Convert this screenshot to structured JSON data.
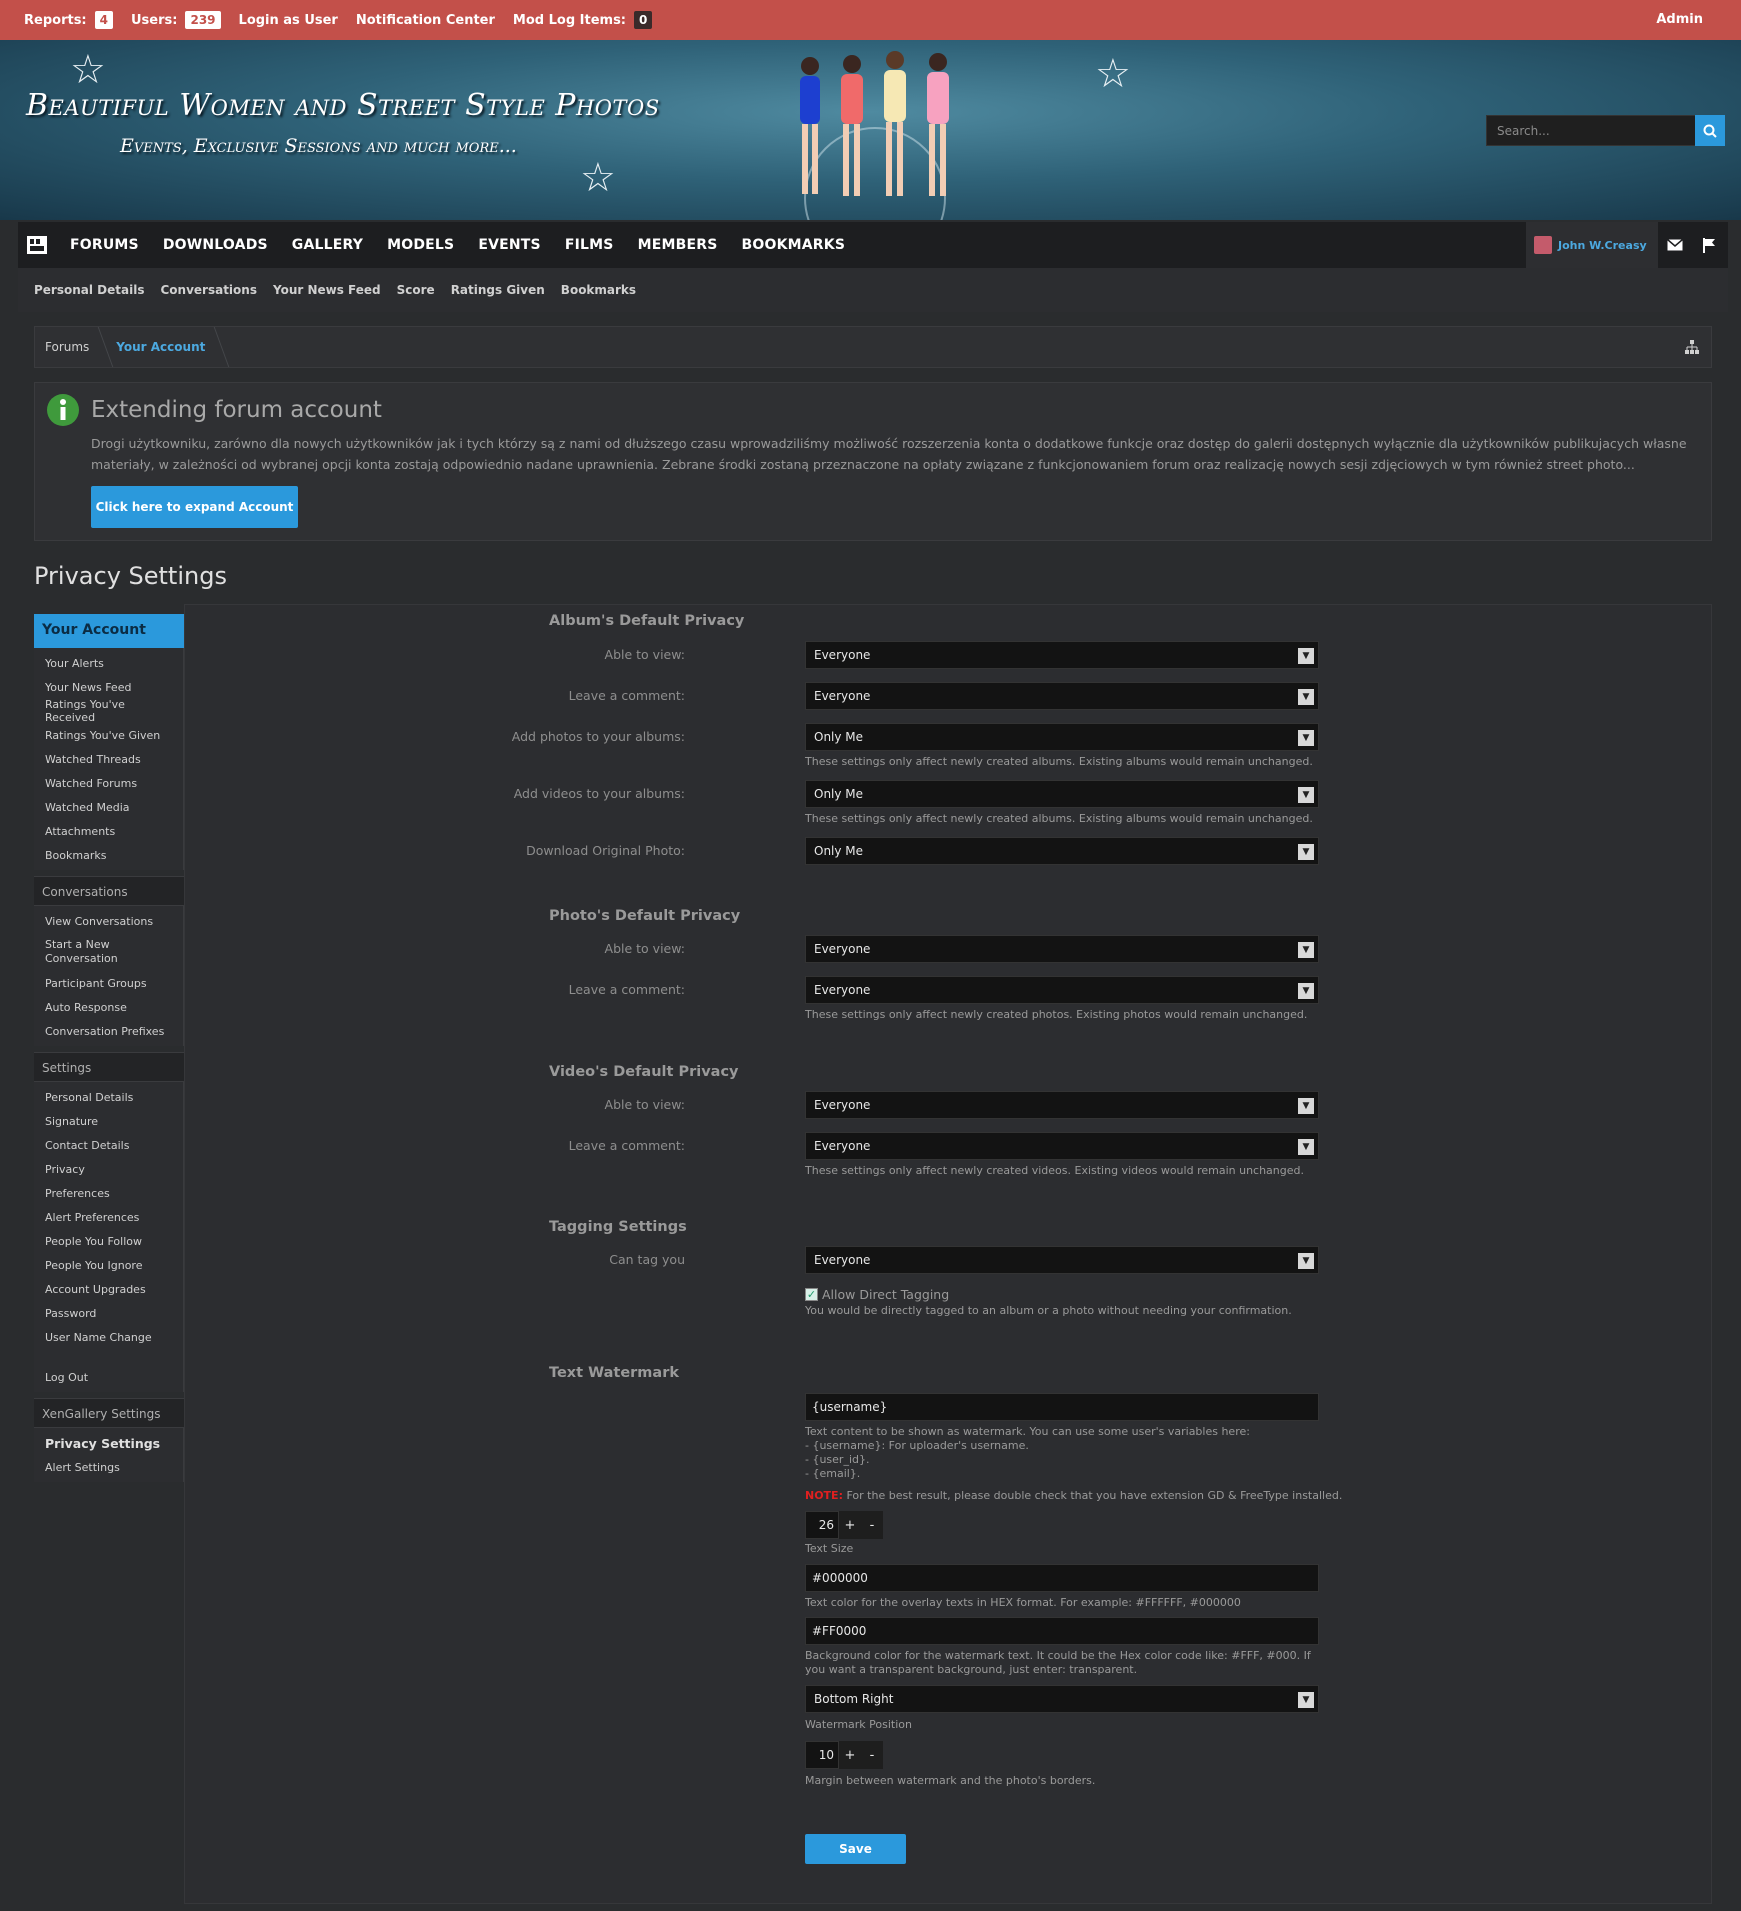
{
  "admin_bar": {
    "reports_label": "Reports:",
    "reports_count": "4",
    "users_label": "Users:",
    "users_count": "239",
    "login_as_user": "Login as User",
    "notification_center": "Notification Center",
    "mod_log_label": "Mod Log Items:",
    "mod_log_count": "0",
    "admin": "Admin"
  },
  "banner": {
    "title": "Beautiful Women and Street Style Photos",
    "subtitle": "Events, Exclusive Sessions and much more...",
    "search_placeholder": "Search..."
  },
  "nav": {
    "tabs": [
      "FORUMS",
      "DOWNLOADS",
      "GALLERY",
      "MODELS",
      "EVENTS",
      "FILMS",
      "MEMBERS",
      "BOOKMARKS"
    ],
    "username": "John W.Creasy"
  },
  "subnav": [
    "Personal Details",
    "Conversations",
    "Your News Feed",
    "Score",
    "Ratings Given",
    "Bookmarks"
  ],
  "breadcrumb": {
    "home": "Forums",
    "current": "Your Account"
  },
  "notice": {
    "title": "Extending forum account",
    "body": "Drogi użytkowniku, zarówno dla nowych użytkowników jak i tych którzy są z nami od dłuższego czasu wprowadziliśmy możliwość rozszerzenia konta o dodatkowe funkcje oraz dostęp do galerii dostępnych wyłącznie dla użytkowników publikujacych własne materiały, w zależności od wybranej opcji konta zostają odpowiednio nadane uprawnienia. Zebrane środki zostaną przeznaczone na opłaty związane z funkcjonowaniem forum oraz realizację nowych sesji zdjęciowych w tym również street photo...",
    "button": "Click here to expand Account"
  },
  "page_title": "Privacy Settings",
  "sidebar": {
    "head": "Your Account",
    "account_links": [
      "Your Alerts",
      "Your News Feed",
      "Ratings You've Received",
      "Ratings You've Given",
      "Watched Threads",
      "Watched Forums",
      "Watched Media",
      "Attachments",
      "Bookmarks"
    ],
    "conversations_head": "Conversations",
    "conversation_links": [
      "View Conversations",
      "Start a New Conversation",
      "Participant Groups",
      "Auto Response",
      "Conversation Prefixes"
    ],
    "settings_head": "Settings",
    "settings_links": [
      "Personal Details",
      "Signature",
      "Contact Details",
      "Privacy",
      "Preferences",
      "Alert Preferences",
      "People You Follow",
      "People You Ignore",
      "Account Upgrades",
      "Password",
      "User Name Change"
    ],
    "logout": "Log Out",
    "gallery_head": "XenGallery Settings",
    "gallery_links": [
      "Privacy Settings",
      "Alert Settings"
    ]
  },
  "form": {
    "album_head": "Album's Default Privacy",
    "album": {
      "view_label": "Able to view:",
      "view_value": "Everyone",
      "comment_label": "Leave a comment:",
      "comment_value": "Everyone",
      "add_photos_label": "Add photos to your albums:",
      "add_photos_value": "Only Me",
      "add_photos_explain": "These settings only affect newly created albums. Existing albums would remain unchanged.",
      "add_videos_label": "Add videos to your albums:",
      "add_videos_value": "Only Me",
      "add_videos_explain": "These settings only affect newly created albums. Existing albums would remain unchanged.",
      "download_label": "Download Original Photo:",
      "download_value": "Only Me"
    },
    "photo_head": "Photo's Default Privacy",
    "photo": {
      "view_label": "Able to view:",
      "view_value": "Everyone",
      "comment_label": "Leave a comment:",
      "comment_value": "Everyone",
      "explain": "These settings only affect newly created photos. Existing photos would remain unchanged."
    },
    "video_head": "Video's Default Privacy",
    "video": {
      "view_label": "Able to view:",
      "view_value": "Everyone",
      "comment_label": "Leave a comment:",
      "comment_value": "Everyone",
      "explain": "These settings only affect newly created videos. Existing videos would remain unchanged."
    },
    "tag_head": "Tagging Settings",
    "tag": {
      "label": "Can tag you",
      "value": "Everyone",
      "checkbox_label": "Allow Direct Tagging",
      "checkbox_checked": true,
      "explain": "You would be directly tagged to an album or a photo without needing your confirmation."
    },
    "watermark_head": "Text Watermark",
    "watermark": {
      "text_value": "{username}",
      "text_explain_1": "Text content to be shown as watermark. You can use some user's variables here:",
      "text_explain_2": "- {username}: For uploader's username.",
      "text_explain_3": "- {user_id}.",
      "text_explain_4": "- {email}.",
      "note_label": "NOTE:",
      "note_text": " For the best result, please double check that you have extension GD & FreeType installed.",
      "size_value": "26",
      "size_label": "Text Size",
      "color_value": "#000000",
      "color_explain": "Text color for the overlay texts in HEX format. For example: #FFFFFF, #000000",
      "bg_value": "#FF0000",
      "bg_explain": "Background color for the watermark text. It could be the Hex color code like: #FFF, #000. If you want a transparent background, just enter: transparent.",
      "position_value": "Bottom Right",
      "position_label": "Watermark Position",
      "margin_value": "10",
      "margin_explain": "Margin between watermark and the photo's borders.",
      "plus": "+",
      "minus": "-"
    },
    "save": "Save"
  }
}
